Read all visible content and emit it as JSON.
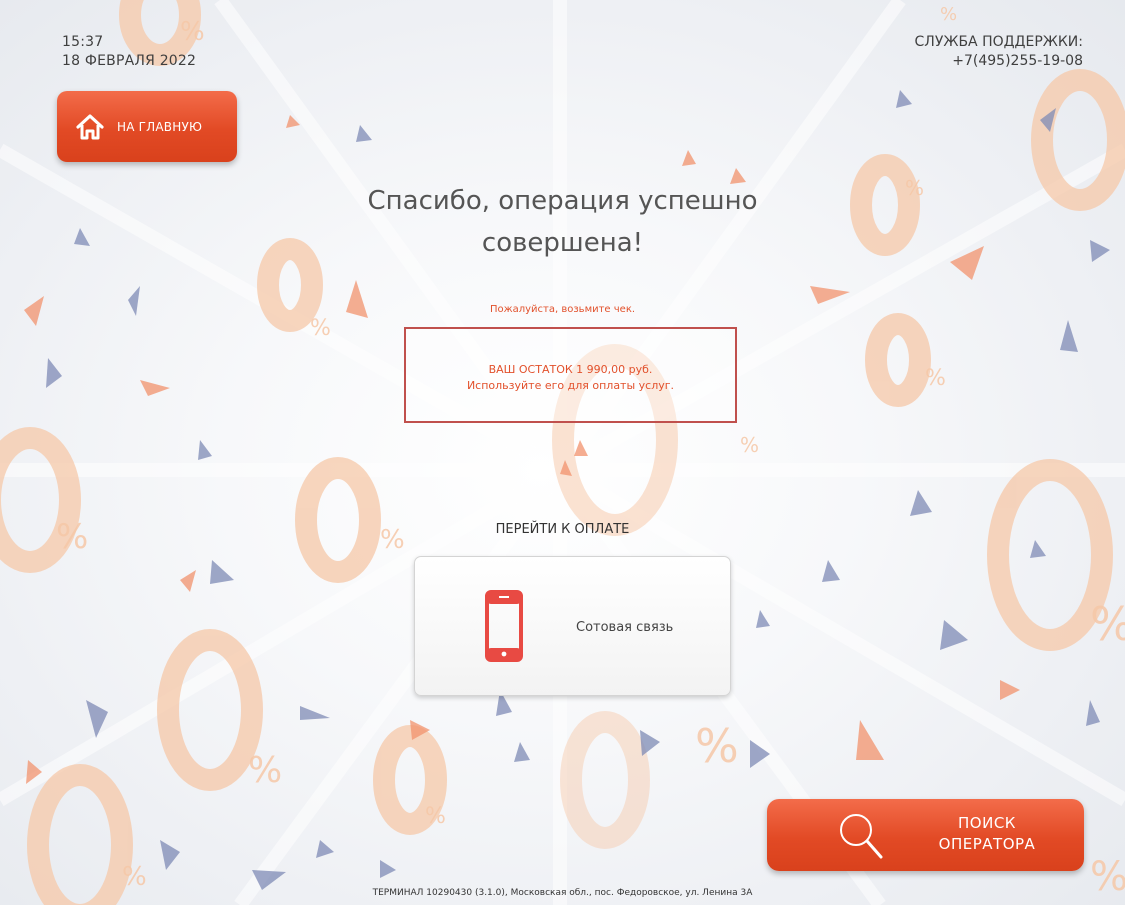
{
  "header": {
    "time": "15:37",
    "date": "18 ФЕВРАЛЯ 2022",
    "support_label": "СЛУЖБА ПОДДЕРЖКИ:",
    "support_phone": "+7(495)255-19-08"
  },
  "nav": {
    "home_label": "НА ГЛАВНУЮ"
  },
  "main": {
    "title_line1": "Спасибо, операция успешно",
    "title_line2": "совершена!",
    "take_receipt": "Пожалуйста, возьмите чек.",
    "balance_line1": "ВАШ ОСТАТОК 1 990,00 руб.",
    "balance_line2": "Используйте его для оплаты услуг.",
    "goto_payment": "ПЕРЕЙТИ К ОПЛАТЕ",
    "service_label": "Сотовая связь",
    "service_icon": "mobile-phone-icon"
  },
  "search": {
    "label_line1": "ПОИСК",
    "label_line2": "ОПЕРАТОРА",
    "icon": "magnifier-icon"
  },
  "footer": {
    "terminal_info": "ТЕРМИНАЛ 10290430 (3.1.0), Московская обл., пос. Федоровское, ул. Ленина 3А"
  },
  "colors": {
    "accent": "#e24a25",
    "text_red": "#e2512c",
    "border_red": "#c0504d",
    "phone_red": "#e84a43"
  }
}
